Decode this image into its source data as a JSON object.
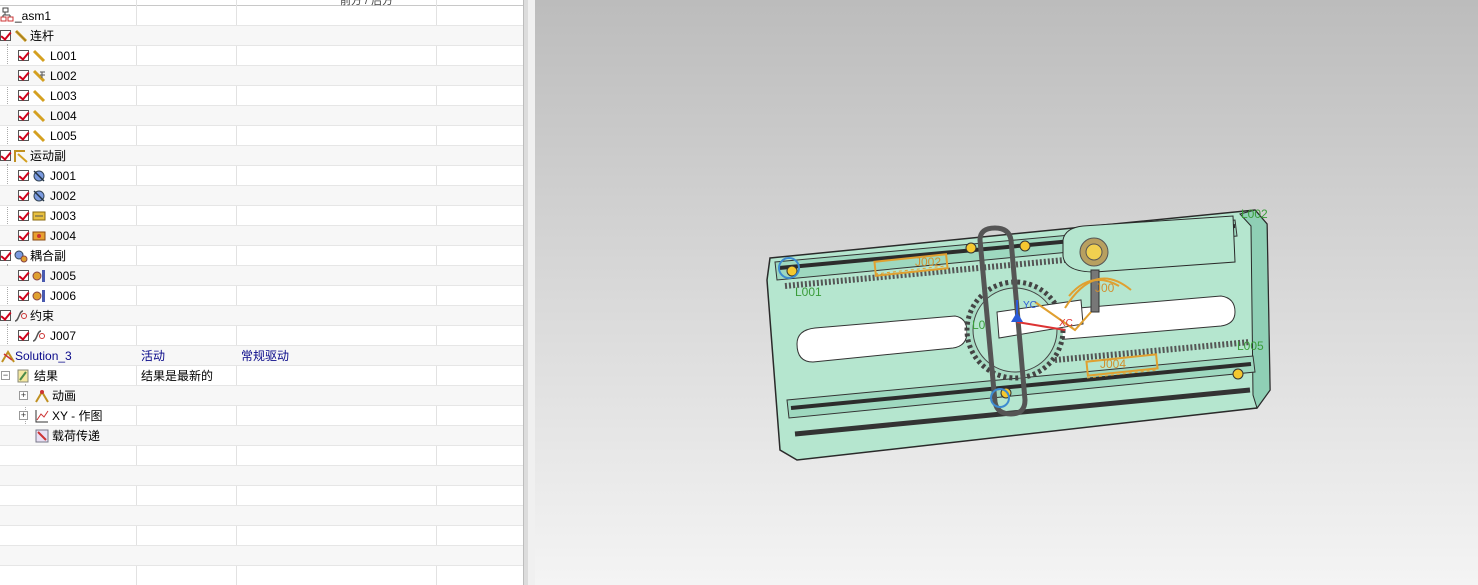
{
  "navigator": {
    "header_text": "前方 / 后方",
    "rows": [
      {
        "name": "_asm1",
        "c2": "",
        "c3": ""
      },
      {
        "name": "连杆"
      },
      {
        "name": "L001"
      },
      {
        "name": "L002"
      },
      {
        "name": "L003"
      },
      {
        "name": "L004"
      },
      {
        "name": "L005"
      },
      {
        "name": "运动副"
      },
      {
        "name": "J001"
      },
      {
        "name": "J002"
      },
      {
        "name": "J003"
      },
      {
        "name": "J004"
      },
      {
        "name": "耦合副"
      },
      {
        "name": "J005"
      },
      {
        "name": "J006"
      },
      {
        "name": "约束"
      },
      {
        "name": "J007"
      },
      {
        "name": "Solution_3",
        "c2": "活动",
        "c3": "常规驱动"
      },
      {
        "name": "结果",
        "c2": "结果是最新的"
      },
      {
        "name": "动画"
      },
      {
        "name": "XY - 作图"
      },
      {
        "name": "载荷传递"
      }
    ]
  },
  "viewport": {
    "labels": {
      "l001": "L001",
      "l002": "L002",
      "l005": "L005",
      "l00x": "L0",
      "j002": "J002",
      "j004": "J004",
      "j00x": "J00",
      "axis_y": "YC",
      "axis_x": "XC"
    },
    "colors": {
      "plate": "#b5e6cf",
      "plate_stroke": "#2a2a2a",
      "joint_orange": "#e0a030",
      "background_top": "#bcbcbc",
      "background_bottom": "#f4f4f4"
    }
  }
}
